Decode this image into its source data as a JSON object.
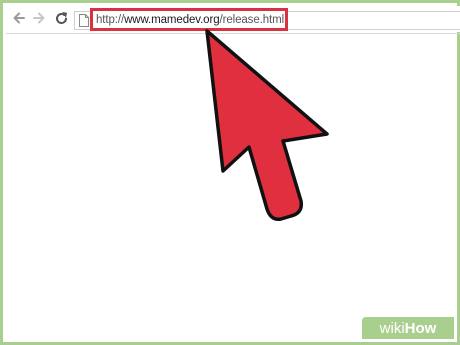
{
  "browser": {
    "nav": {
      "back_icon": "arrow-left-icon",
      "forward_icon": "arrow-right-icon",
      "reload_icon": "reload-icon"
    },
    "address_bar": {
      "prefix": "http://",
      "host": "www.mamedev.org",
      "path": "/release.html",
      "page_icon": "page-icon"
    }
  },
  "overlay": {
    "cursor_icon": "mouse-pointer-icon",
    "cursor_color": "#e0303f",
    "highlight_color": "#d8313f"
  },
  "watermark": {
    "part1": "wiki",
    "part2": "How",
    "color": "#a9cf8e"
  }
}
